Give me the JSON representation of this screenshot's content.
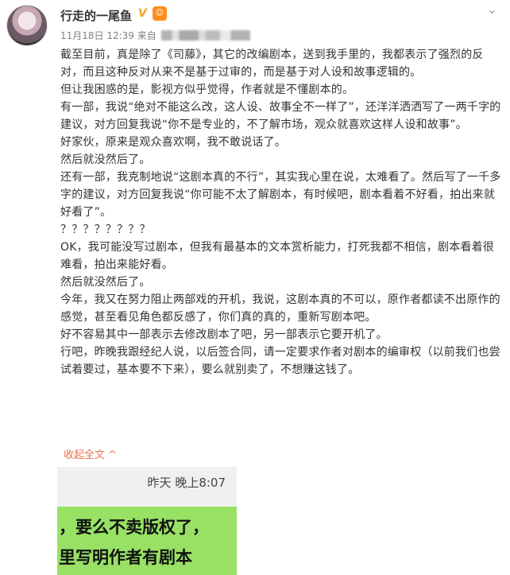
{
  "post": {
    "username": "行走的一尾鱼",
    "verified_mark": "V",
    "meta": {
      "date": "11月18日 12:39",
      "source_prefix": "来自"
    },
    "paragraphs": [
      "截至目前，真是除了《司藤》，其它的改编剧本，送到我手里的，我都表示了强烈的反对，而且这种反对从来不是基于过审的，而是基于对人设和故事逻辑的。",
      "但让我困惑的是，影视方似乎觉得，作者就是不懂剧本的。",
      "有一部，我说“绝对不能这么改，这人设、故事全不一样了”，还洋洋洒洒写了一两千字的建议，对方回复我说“你不是专业的，不了解市场，观众就喜欢这样人设和故事”。",
      "好家伙，原来是观众喜欢啊，我不敢说话了。",
      "然后就没然后了。",
      "还有一部，我克制地说“这剧本真的不行”，其实我心里在说，太难看了。然后写了一千多字的建议，对方回复我说“你可能不太了解剧本，有时候吧，剧本看着不好看，拍出来就好看了”。",
      "？？？？？？？？",
      "OK，我可能没写过剧本，但我有最基本的文本赏析能力，打死我都不相信，剧本看着很难看，拍出来能好看。",
      "然后就没然后了。",
      "今年，我又在努力阻止两部戏的开机，我说，这剧本真的不可以，原作者都读不出原作的感觉，甚至看见角色都反感了，你们真的真的，重新写剧本吧。",
      "好不容易其中一部表示去修改剧本了吧，另一部表示它要开机了。",
      "行吧，昨晚我跟经纪人说，以后签合同，请一定要求作者对剧本的编审权（以前我们也尝试着要过，基本要不下来），要么就别卖了，不想赚这钱了。"
    ],
    "collapse_label": "收起全文 ^"
  },
  "thumbnail": {
    "time": "昨天 晚上8:07",
    "lines": [
      "，要么不卖版权了，",
      "里写明作者有剧本"
    ]
  },
  "colors": {
    "link": "#eb7350",
    "chat_bubble": "#98e165"
  },
  "icons": [
    "avatar",
    "verified-badge",
    "member-badge",
    "more-icon"
  ]
}
